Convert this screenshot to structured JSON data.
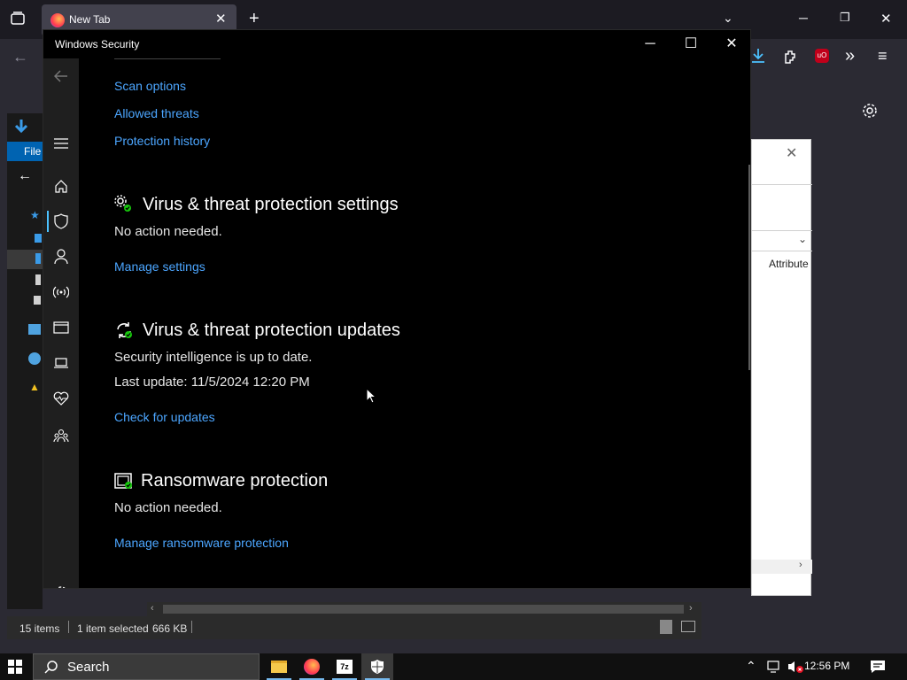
{
  "browser": {
    "tab_title": "New Tab"
  },
  "explorer": {
    "menu_file": "File",
    "column_attributes": "Attribute",
    "status_items": "15 items",
    "status_selected": "1 item selected",
    "status_size": "666 KB"
  },
  "security": {
    "window_title": "Windows Security",
    "top_links": [
      "Scan options",
      "Allowed threats",
      "Protection history"
    ],
    "settings": {
      "title": "Virus & threat protection settings",
      "status": "No action needed.",
      "link": "Manage settings"
    },
    "updates": {
      "title": "Virus & threat protection updates",
      "status": "Security intelligence is up to date.",
      "last_update": "Last update: 11/5/2024 12:20 PM",
      "link": "Check for updates"
    },
    "ransomware": {
      "title": "Ransomware protection",
      "status": "No action needed.",
      "link": "Manage ransomware protection"
    }
  },
  "taskbar": {
    "search_label": "Search",
    "clock": "12:56 PM"
  },
  "colors": {
    "link": "#4ca6ff",
    "accent": "#4cc2ff",
    "window_bg": "#000000"
  }
}
